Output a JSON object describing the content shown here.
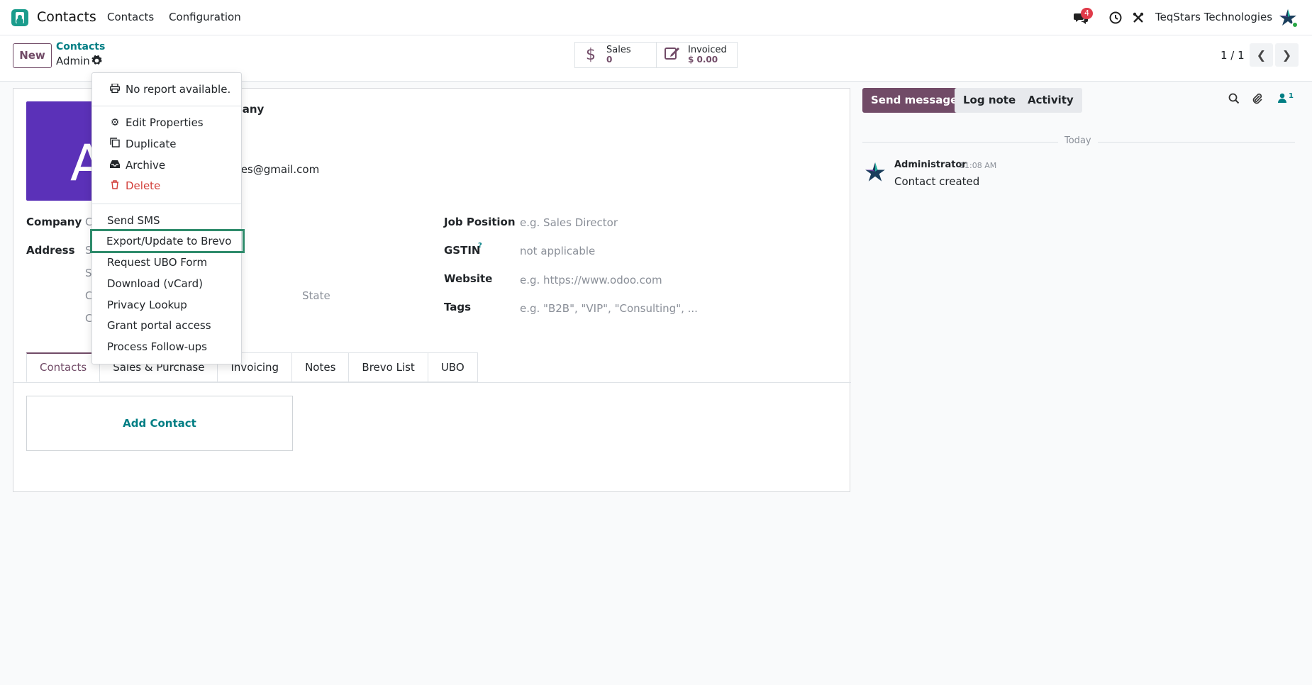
{
  "navbar": {
    "app_name": "Contacts",
    "menu": [
      "Contacts",
      "Configuration"
    ],
    "notification_count": "4",
    "company": "TeqStars Technologies"
  },
  "control_panel": {
    "new_label": "New",
    "breadcrumb_parent": "Contacts",
    "breadcrumb_current": "Admin",
    "stats": [
      {
        "label": "Sales",
        "value": "0",
        "icon": "dollar-icon"
      },
      {
        "label": "Invoiced",
        "value": "$ 0.00",
        "icon": "edit-icon"
      }
    ],
    "pager": "1 / 1"
  },
  "form": {
    "avatar_letter": "A",
    "company_type_fragment": "pany",
    "email_fragment": "gies@gmail.com",
    "company_label": "Company",
    "address_label": "Address",
    "address_fragments": [
      "C",
      "S",
      "S",
      "C",
      "C"
    ],
    "state_placeholder": "State",
    "right_fields": [
      {
        "label": "Job Position",
        "value": "e.g. Sales Director"
      },
      {
        "label": "GSTIN",
        "value": "not applicable"
      },
      {
        "label": "Website",
        "value": "e.g. https://www.odoo.com"
      },
      {
        "label": "Tags",
        "value": "e.g. \"B2B\", \"VIP\", \"Consulting\", ..."
      }
    ],
    "gstin_help": "?",
    "tabs": [
      "Contacts",
      "Sales & Purchase",
      "Invoicing",
      "Notes",
      "Brevo List",
      "UBO"
    ],
    "add_contact": "Add Contact"
  },
  "chatter": {
    "send_message": "Send message",
    "log_note": "Log note",
    "activity": "Activity",
    "follower_count": "1",
    "today": "Today",
    "message": {
      "author": "Administrator",
      "time": "11:08 AM",
      "body": "Contact created"
    }
  },
  "dropdown": {
    "print": "No report available.",
    "actions": [
      "Edit Properties",
      "Duplicate",
      "Archive",
      "Delete"
    ],
    "extra": [
      "Send SMS",
      "Export/Update to Brevo",
      "Request UBO Form",
      "Download (vCard)",
      "Privacy Lookup",
      "Grant portal access",
      "Process Follow-ups"
    ]
  }
}
